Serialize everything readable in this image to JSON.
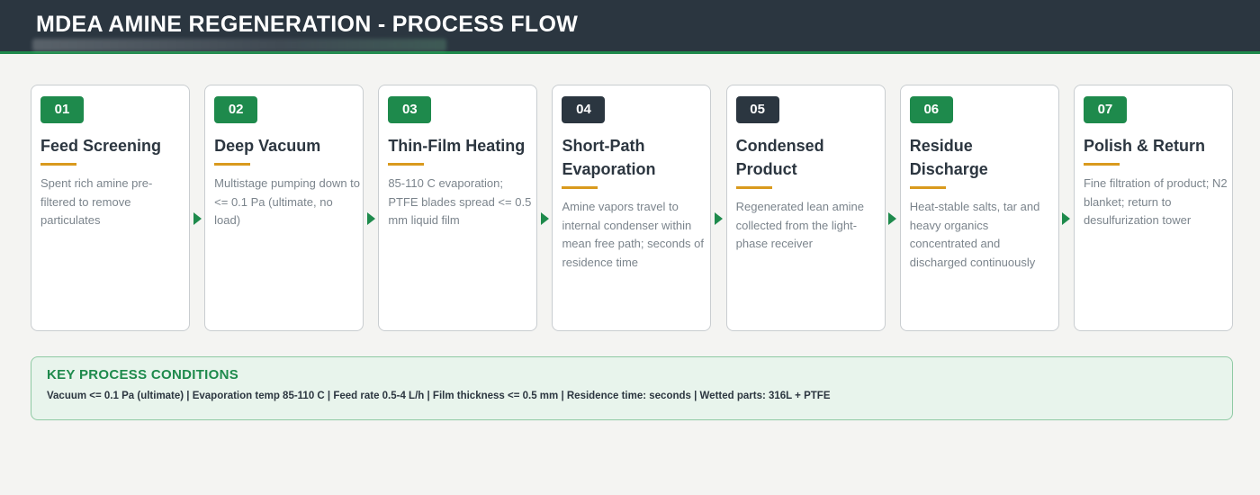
{
  "header": {
    "title": "MDEA AMINE REGENERATION - PROCESS FLOW"
  },
  "steps": [
    {
      "number": "01",
      "title": "Feed Screening",
      "desc": "Spent rich amine pre-filtered to remove particulates",
      "badge_color": "#1e8a4c"
    },
    {
      "number": "02",
      "title": "Deep Vacuum",
      "desc": "Multistage pumping down to <= 0.1 Pa (ultimate, no load)",
      "badge_color": "#1e8a4c"
    },
    {
      "number": "03",
      "title": "Thin-Film Heating",
      "desc": "85-110 C evaporation; PTFE blades spread <= 0.5 mm liquid film",
      "badge_color": "#1e8a4c"
    },
    {
      "number": "04",
      "title": "Short-Path Evaporation",
      "desc": "Amine vapors travel to internal condenser within mean free path; seconds of residence time",
      "badge_color": "#2b3640"
    },
    {
      "number": "05",
      "title": "Condensed Product",
      "desc": "Regenerated lean amine collected from the light-phase receiver",
      "badge_color": "#2b3640"
    },
    {
      "number": "06",
      "title": "Residue Discharge",
      "desc": "Heat-stable salts, tar and heavy organics concentrated and discharged continuously",
      "badge_color": "#1e8a4c"
    },
    {
      "number": "07",
      "title": "Polish & Return",
      "desc": "Fine filtration of product; N2 blanket; return to desulfurization tower",
      "badge_color": "#1e8a4c"
    }
  ],
  "conditions": {
    "title": "KEY PROCESS CONDITIONS",
    "text": "Vacuum <= 0.1 Pa (ultimate)   |   Evaporation temp 85-110 C   |   Feed rate 0.5-4 L/h   |   Film thickness <= 0.5 mm   |   Residence time: seconds   |   Wetted parts: 316L + PTFE"
  },
  "colors": {
    "accent_green": "#1e8a4c",
    "header_dark": "#2b3640",
    "rule_amber": "#d99a1e"
  }
}
